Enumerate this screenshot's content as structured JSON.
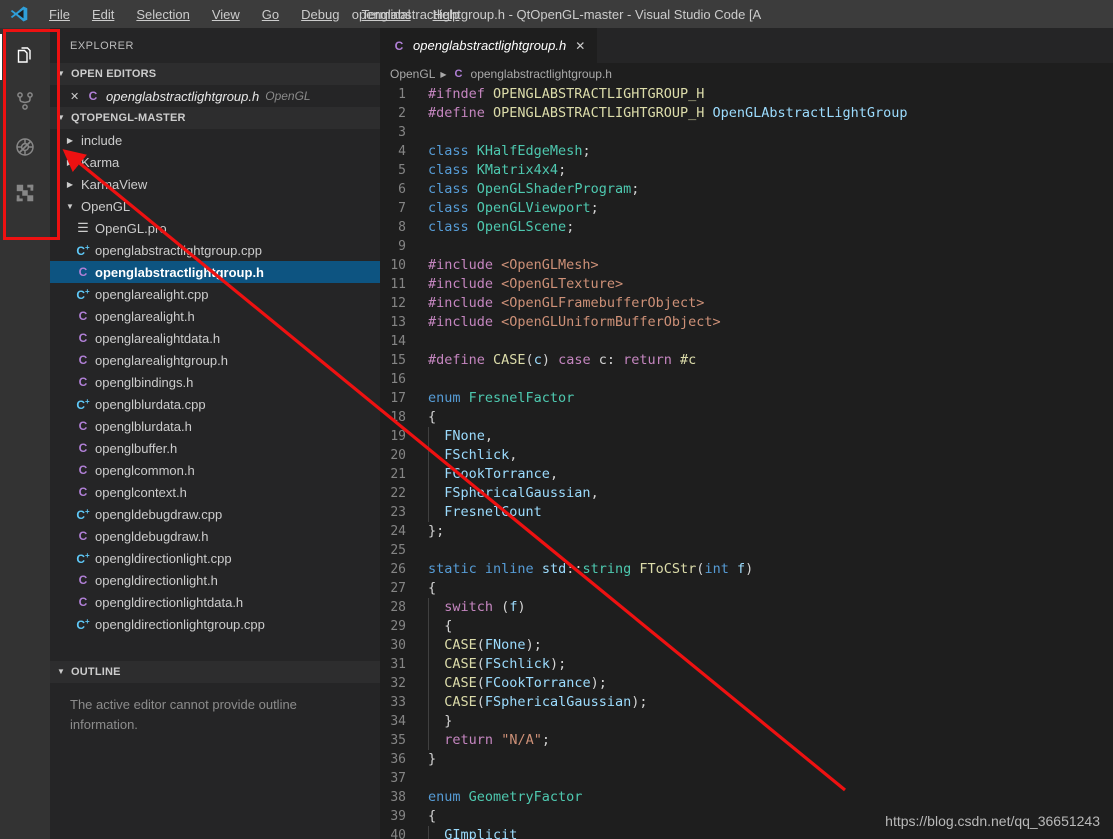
{
  "titlebar": {
    "logo_icon": "vscode-logo-icon",
    "menus": [
      "File",
      "Edit",
      "Selection",
      "View",
      "Go",
      "Debug",
      "Terminal",
      "Help"
    ],
    "title": "openglabstractlightgroup.h - QtOpenGL-master - Visual Studio Code [A"
  },
  "activitybar": {
    "items": [
      {
        "name": "explorer",
        "icon": "files-icon",
        "active": true
      },
      {
        "name": "source-control",
        "icon": "source-control-branch-icon",
        "active": false
      },
      {
        "name": "debug",
        "icon": "debug-disabled-icon",
        "active": false
      },
      {
        "name": "extensions",
        "icon": "extensions-blocks-icon",
        "active": false
      }
    ]
  },
  "sidebar": {
    "title": "EXPLORER",
    "open_editors": {
      "header": "OPEN EDITORS",
      "items": [
        {
          "close": "✕",
          "icon": "C",
          "icon_type": "h",
          "name": "openglabstractlightgroup.h",
          "description": "OpenGL"
        }
      ]
    },
    "project": {
      "header": "QTOPENGL-MASTER",
      "items": [
        {
          "label": "include",
          "kind": "folder",
          "expanded": false,
          "indent": 1
        },
        {
          "label": "Karma",
          "kind": "folder",
          "expanded": false,
          "indent": 1
        },
        {
          "label": "KarmaView",
          "kind": "folder",
          "expanded": false,
          "indent": 1
        },
        {
          "label": "OpenGL",
          "kind": "folder",
          "expanded": true,
          "indent": 1
        },
        {
          "label": "OpenGL.pro",
          "kind": "file",
          "icon_type": "pro",
          "icon": "☰",
          "indent": 2
        },
        {
          "label": "openglabstractlightgroup.cpp",
          "kind": "file",
          "icon_type": "cpp",
          "icon": "C",
          "indent": 2
        },
        {
          "label": "openglabstractlightgroup.h",
          "kind": "file",
          "icon_type": "h",
          "icon": "C",
          "indent": 2,
          "selected": true
        },
        {
          "label": "openglarealight.cpp",
          "kind": "file",
          "icon_type": "cpp",
          "icon": "C",
          "indent": 2
        },
        {
          "label": "openglarealight.h",
          "kind": "file",
          "icon_type": "h",
          "icon": "C",
          "indent": 2
        },
        {
          "label": "openglarealightdata.h",
          "kind": "file",
          "icon_type": "h",
          "icon": "C",
          "indent": 2
        },
        {
          "label": "openglarealightgroup.h",
          "kind": "file",
          "icon_type": "h",
          "icon": "C",
          "indent": 2
        },
        {
          "label": "openglbindings.h",
          "kind": "file",
          "icon_type": "h",
          "icon": "C",
          "indent": 2
        },
        {
          "label": "openglblurdata.cpp",
          "kind": "file",
          "icon_type": "cpp",
          "icon": "C",
          "indent": 2
        },
        {
          "label": "openglblurdata.h",
          "kind": "file",
          "icon_type": "h",
          "icon": "C",
          "indent": 2
        },
        {
          "label": "openglbuffer.h",
          "kind": "file",
          "icon_type": "h",
          "icon": "C",
          "indent": 2
        },
        {
          "label": "openglcommon.h",
          "kind": "file",
          "icon_type": "h",
          "icon": "C",
          "indent": 2
        },
        {
          "label": "openglcontext.h",
          "kind": "file",
          "icon_type": "h",
          "icon": "C",
          "indent": 2
        },
        {
          "label": "opengldebugdraw.cpp",
          "kind": "file",
          "icon_type": "cpp",
          "icon": "C",
          "indent": 2
        },
        {
          "label": "opengldebugdraw.h",
          "kind": "file",
          "icon_type": "h",
          "icon": "C",
          "indent": 2
        },
        {
          "label": "opengldirectionlight.cpp",
          "kind": "file",
          "icon_type": "cpp",
          "icon": "C",
          "indent": 2
        },
        {
          "label": "opengldirectionlight.h",
          "kind": "file",
          "icon_type": "h",
          "icon": "C",
          "indent": 2
        },
        {
          "label": "opengldirectionlightdata.h",
          "kind": "file",
          "icon_type": "h",
          "icon": "C",
          "indent": 2
        },
        {
          "label": "opengldirectionlightgroup.cpp",
          "kind": "file",
          "icon_type": "cpp",
          "icon": "C",
          "indent": 2
        }
      ]
    },
    "outline": {
      "header": "OUTLINE",
      "message": "The active editor cannot provide outline information."
    }
  },
  "editor": {
    "tab": {
      "icon": "C",
      "icon_type": "h",
      "name": "openglabstractlightgroup.h",
      "close": "✕"
    },
    "breadcrumbs": [
      {
        "label": "OpenGL",
        "icon": null
      },
      {
        "label": "openglabstractlightgroup.h",
        "icon": "C",
        "icon_type": "h"
      }
    ],
    "watermark": "https://blog.csdn.net/qq_36651243",
    "first_line": 1,
    "lines": [
      {
        "n": 1,
        "tokens": [
          {
            "t": "#ifndef ",
            "c": "pre"
          },
          {
            "t": "OPENGLABSTRACTLIGHTGROUP_H",
            "c": "macro"
          }
        ]
      },
      {
        "n": 2,
        "tokens": [
          {
            "t": "#define ",
            "c": "pre"
          },
          {
            "t": "OPENGLABSTRACTLIGHTGROUP_H",
            "c": "macro"
          },
          {
            "t": " ",
            "c": "plain"
          },
          {
            "t": "OpenGLAbstractLightGroup",
            "c": "var"
          }
        ]
      },
      {
        "n": 3,
        "tokens": []
      },
      {
        "n": 4,
        "tokens": [
          {
            "t": "class ",
            "c": "kw"
          },
          {
            "t": "KHalfEdgeMesh",
            "c": "type"
          },
          {
            "t": ";",
            "c": "plain"
          }
        ]
      },
      {
        "n": 5,
        "tokens": [
          {
            "t": "class ",
            "c": "kw"
          },
          {
            "t": "KMatrix4x4",
            "c": "type"
          },
          {
            "t": ";",
            "c": "plain"
          }
        ]
      },
      {
        "n": 6,
        "tokens": [
          {
            "t": "class ",
            "c": "kw"
          },
          {
            "t": "OpenGLShaderProgram",
            "c": "type"
          },
          {
            "t": ";",
            "c": "plain"
          }
        ]
      },
      {
        "n": 7,
        "tokens": [
          {
            "t": "class ",
            "c": "kw"
          },
          {
            "t": "OpenGLViewport",
            "c": "type"
          },
          {
            "t": ";",
            "c": "plain"
          }
        ]
      },
      {
        "n": 8,
        "tokens": [
          {
            "t": "class ",
            "c": "kw"
          },
          {
            "t": "OpenGLScene",
            "c": "type"
          },
          {
            "t": ";",
            "c": "plain"
          }
        ]
      },
      {
        "n": 9,
        "tokens": []
      },
      {
        "n": 10,
        "tokens": [
          {
            "t": "#include ",
            "c": "pre"
          },
          {
            "t": "<OpenGLMesh>",
            "c": "str"
          }
        ]
      },
      {
        "n": 11,
        "tokens": [
          {
            "t": "#include ",
            "c": "pre"
          },
          {
            "t": "<OpenGLTexture>",
            "c": "str"
          }
        ]
      },
      {
        "n": 12,
        "tokens": [
          {
            "t": "#include ",
            "c": "pre"
          },
          {
            "t": "<OpenGLFramebufferObject>",
            "c": "str"
          }
        ]
      },
      {
        "n": 13,
        "tokens": [
          {
            "t": "#include ",
            "c": "pre"
          },
          {
            "t": "<OpenGLUniformBufferObject>",
            "c": "str"
          }
        ]
      },
      {
        "n": 14,
        "tokens": []
      },
      {
        "n": 15,
        "tokens": [
          {
            "t": "#define ",
            "c": "pre"
          },
          {
            "t": "CASE",
            "c": "macro"
          },
          {
            "t": "(",
            "c": "plain"
          },
          {
            "t": "c",
            "c": "var"
          },
          {
            "t": ") ",
            "c": "plain"
          },
          {
            "t": "case",
            "c": "ctrl"
          },
          {
            "t": " c: ",
            "c": "plain"
          },
          {
            "t": "return",
            "c": "ctrl"
          },
          {
            "t": " ",
            "c": "plain"
          },
          {
            "t": "#c",
            "c": "macro"
          }
        ]
      },
      {
        "n": 16,
        "tokens": []
      },
      {
        "n": 17,
        "tokens": [
          {
            "t": "enum ",
            "c": "kw"
          },
          {
            "t": "FresnelFactor",
            "c": "type"
          }
        ]
      },
      {
        "n": 18,
        "tokens": [
          {
            "t": "{",
            "c": "plain"
          }
        ]
      },
      {
        "n": 19,
        "tokens": [
          {
            "t": "  ",
            "c": "plain"
          },
          {
            "t": "FNone",
            "c": "var"
          },
          {
            "t": ",",
            "c": "plain"
          }
        ],
        "guide": 1
      },
      {
        "n": 20,
        "tokens": [
          {
            "t": "  ",
            "c": "plain"
          },
          {
            "t": "FSchlick",
            "c": "var"
          },
          {
            "t": ",",
            "c": "plain"
          }
        ],
        "guide": 1
      },
      {
        "n": 21,
        "tokens": [
          {
            "t": "  ",
            "c": "plain"
          },
          {
            "t": "FCookTorrance",
            "c": "var"
          },
          {
            "t": ",",
            "c": "plain"
          }
        ],
        "guide": 1
      },
      {
        "n": 22,
        "tokens": [
          {
            "t": "  ",
            "c": "plain"
          },
          {
            "t": "FSphericalGaussian",
            "c": "var"
          },
          {
            "t": ",",
            "c": "plain"
          }
        ],
        "guide": 1
      },
      {
        "n": 23,
        "tokens": [
          {
            "t": "  ",
            "c": "plain"
          },
          {
            "t": "FresnelCount",
            "c": "var"
          }
        ],
        "guide": 1
      },
      {
        "n": 24,
        "tokens": [
          {
            "t": "};",
            "c": "plain"
          }
        ]
      },
      {
        "n": 25,
        "tokens": []
      },
      {
        "n": 26,
        "tokens": [
          {
            "t": "static ",
            "c": "kw"
          },
          {
            "t": "inline ",
            "c": "kw"
          },
          {
            "t": "std",
            "c": "var"
          },
          {
            "t": "::",
            "c": "plain"
          },
          {
            "t": "string",
            "c": "type"
          },
          {
            "t": " ",
            "c": "plain"
          },
          {
            "t": "FToCStr",
            "c": "fn"
          },
          {
            "t": "(",
            "c": "plain"
          },
          {
            "t": "int",
            "c": "kw"
          },
          {
            "t": " ",
            "c": "plain"
          },
          {
            "t": "f",
            "c": "var"
          },
          {
            "t": ")",
            "c": "plain"
          }
        ]
      },
      {
        "n": 27,
        "tokens": [
          {
            "t": "{",
            "c": "plain"
          }
        ]
      },
      {
        "n": 28,
        "tokens": [
          {
            "t": "  ",
            "c": "plain"
          },
          {
            "t": "switch",
            "c": "ctrl"
          },
          {
            "t": " (",
            "c": "plain"
          },
          {
            "t": "f",
            "c": "var"
          },
          {
            "t": ")",
            "c": "plain"
          }
        ],
        "guide": 1
      },
      {
        "n": 29,
        "tokens": [
          {
            "t": "  {",
            "c": "plain"
          }
        ],
        "guide": 1
      },
      {
        "n": 30,
        "tokens": [
          {
            "t": "  ",
            "c": "plain"
          },
          {
            "t": "CASE",
            "c": "macro"
          },
          {
            "t": "(",
            "c": "plain"
          },
          {
            "t": "FNone",
            "c": "var"
          },
          {
            "t": ");",
            "c": "plain"
          }
        ],
        "guide": 1
      },
      {
        "n": 31,
        "tokens": [
          {
            "t": "  ",
            "c": "plain"
          },
          {
            "t": "CASE",
            "c": "macro"
          },
          {
            "t": "(",
            "c": "plain"
          },
          {
            "t": "FSchlick",
            "c": "var"
          },
          {
            "t": ");",
            "c": "plain"
          }
        ],
        "guide": 1
      },
      {
        "n": 32,
        "tokens": [
          {
            "t": "  ",
            "c": "plain"
          },
          {
            "t": "CASE",
            "c": "macro"
          },
          {
            "t": "(",
            "c": "plain"
          },
          {
            "t": "FCookTorrance",
            "c": "var"
          },
          {
            "t": ");",
            "c": "plain"
          }
        ],
        "guide": 1
      },
      {
        "n": 33,
        "tokens": [
          {
            "t": "  ",
            "c": "plain"
          },
          {
            "t": "CASE",
            "c": "macro"
          },
          {
            "t": "(",
            "c": "plain"
          },
          {
            "t": "FSphericalGaussian",
            "c": "var"
          },
          {
            "t": ");",
            "c": "plain"
          }
        ],
        "guide": 1
      },
      {
        "n": 34,
        "tokens": [
          {
            "t": "  }",
            "c": "plain"
          }
        ],
        "guide": 1
      },
      {
        "n": 35,
        "tokens": [
          {
            "t": "  ",
            "c": "plain"
          },
          {
            "t": "return",
            "c": "ctrl"
          },
          {
            "t": " ",
            "c": "plain"
          },
          {
            "t": "\"N/A\"",
            "c": "str"
          },
          {
            "t": ";",
            "c": "plain"
          }
        ],
        "guide": 1
      },
      {
        "n": 36,
        "tokens": [
          {
            "t": "}",
            "c": "plain"
          }
        ]
      },
      {
        "n": 37,
        "tokens": []
      },
      {
        "n": 38,
        "tokens": [
          {
            "t": "enum ",
            "c": "kw"
          },
          {
            "t": "GeometryFactor",
            "c": "type"
          }
        ]
      },
      {
        "n": 39,
        "tokens": [
          {
            "t": "{",
            "c": "plain"
          }
        ]
      },
      {
        "n": 40,
        "tokens": [
          {
            "t": "  ",
            "c": "plain"
          },
          {
            "t": "GImplicit",
            "c": "var"
          }
        ],
        "guide": 1
      }
    ]
  },
  "annotations": {
    "rect_color": "#ee1111",
    "arrow_color": "#ee1111",
    "arrow_label": "arrow-pointing-to-activity-bar"
  },
  "colors": {
    "titlebar_bg": "#3c3c3c",
    "activitybar_bg": "#333333",
    "sidebar_bg": "#252526",
    "editor_bg": "#1e1e1e",
    "selection_blue": "#0d5481",
    "accent_red": "#ee1111"
  }
}
